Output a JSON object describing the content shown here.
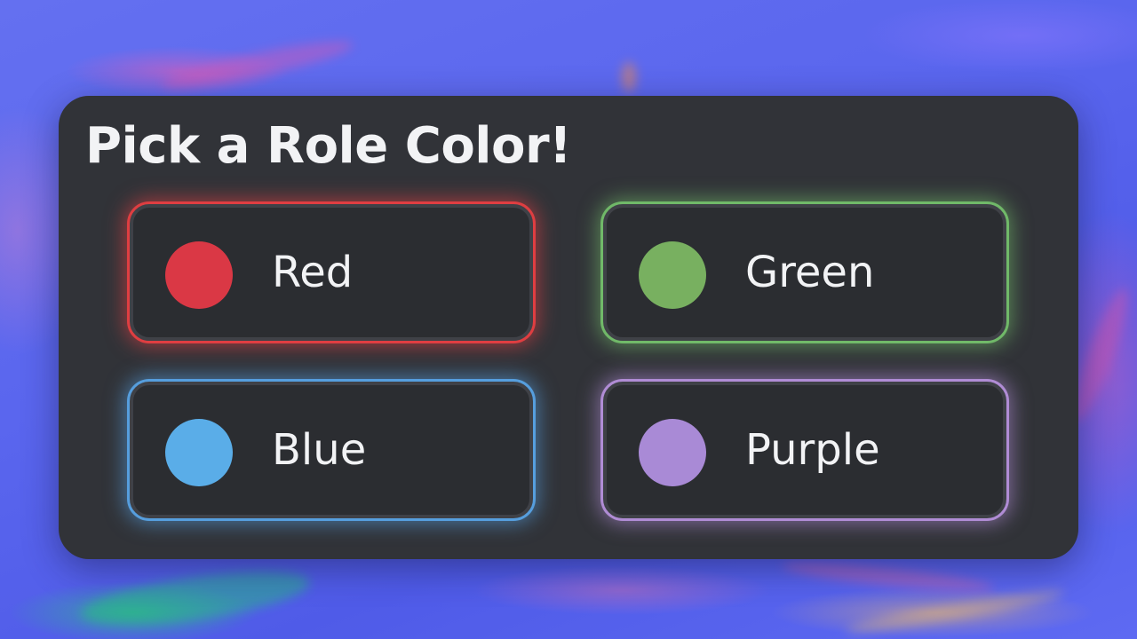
{
  "title": "Pick a Role Color!",
  "roles": [
    {
      "label": "Red",
      "color": "#da3845"
    },
    {
      "label": "Green",
      "color": "#78b060"
    },
    {
      "label": "Blue",
      "color": "#5aade8"
    },
    {
      "label": "Purple",
      "color": "#a98ad6"
    }
  ],
  "theme": {
    "panel_bg": "#313338",
    "button_bg": "#2b2d31",
    "text_color": "#f2f3f5",
    "backdrop": "#5865f2"
  }
}
